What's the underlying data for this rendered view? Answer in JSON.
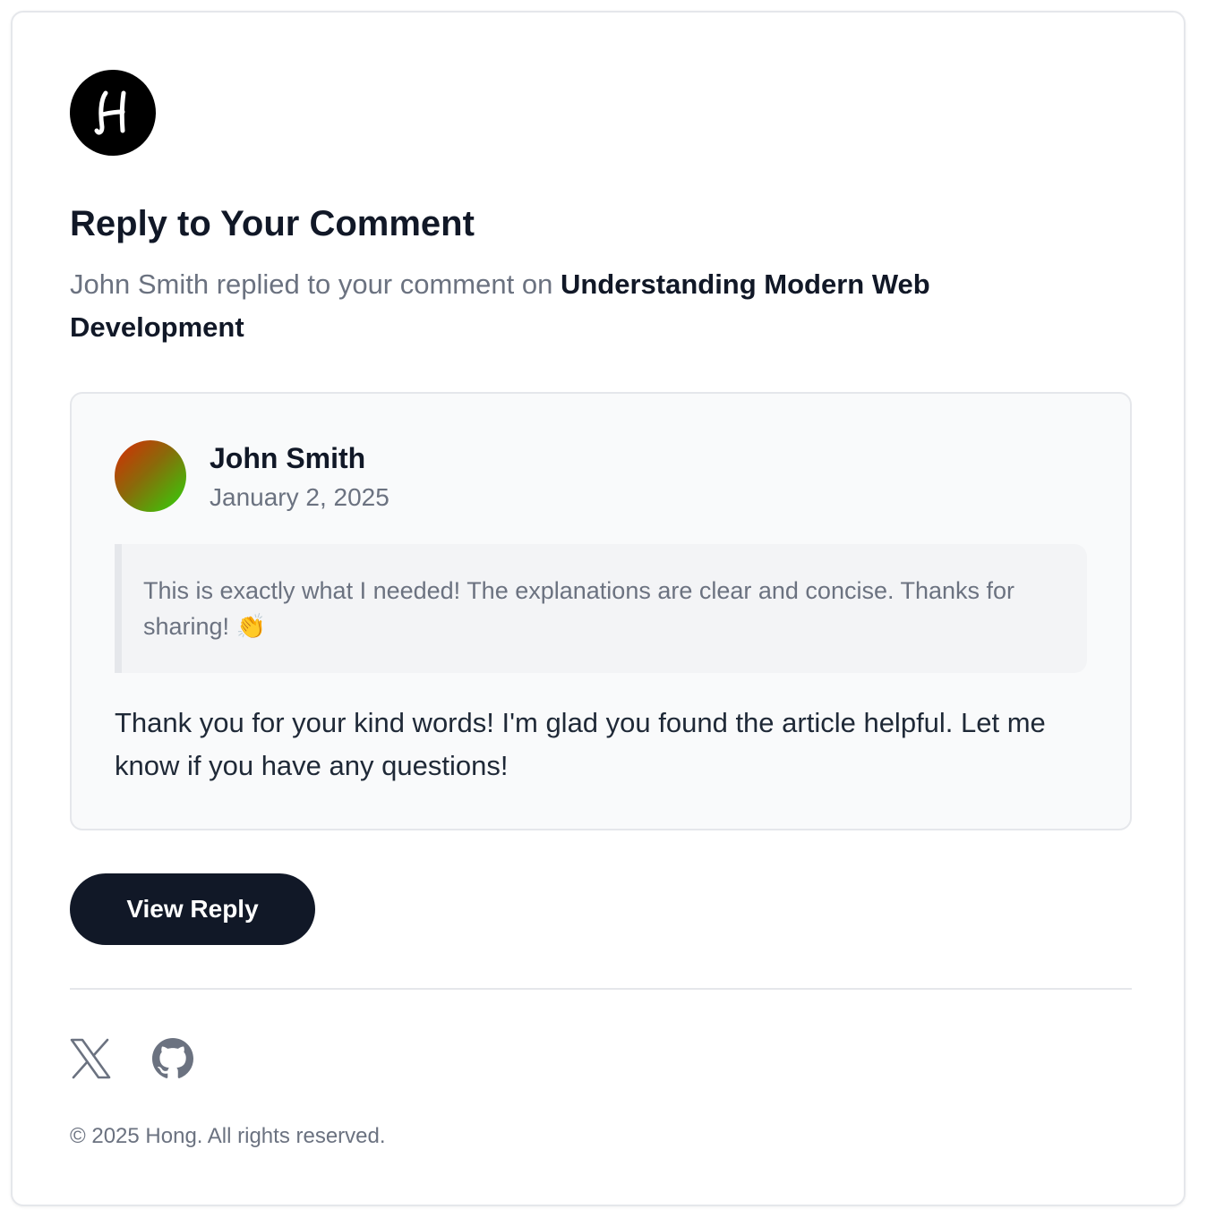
{
  "header": {
    "logo_letter": "H",
    "title": "Reply to Your Comment",
    "subtitle_prefix": "John Smith replied to your comment on",
    "article_title": "Understanding Modern Web Development"
  },
  "comment": {
    "author": "John Smith",
    "date": "January 2, 2025",
    "avatar_gradient": [
      "#d82a05",
      "#2ed40a"
    ],
    "original_comment": "This is exactly what I needed! The explanations are clear and concise. Thanks for sharing! 👏",
    "reply": "Thank you for your kind words! I'm glad you found the article helpful. Let me know if you have any questions!"
  },
  "actions": {
    "view_reply_label": "View Reply"
  },
  "footer": {
    "social_icons": [
      "x-icon",
      "github-icon"
    ],
    "copyright": "© 2025 Hong. All rights reserved."
  },
  "colors": {
    "primary": "#111827",
    "muted_text": "#6b7280",
    "border": "#e5e7eb",
    "panel_bg": "#f9fafb",
    "quote_bg": "#f3f4f6"
  }
}
